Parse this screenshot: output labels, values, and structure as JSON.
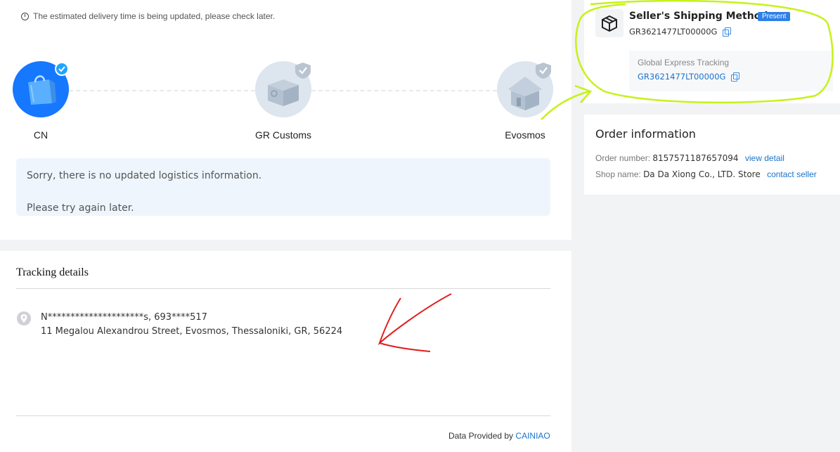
{
  "delivery_notice": "The estimated delivery time is being updated, please check later.",
  "progress": {
    "nodes": [
      {
        "label": "CN",
        "icon": "shopping-bag-icon",
        "status": "current"
      },
      {
        "label": "GR Customs",
        "icon": "customs-box-icon",
        "status": "pending"
      },
      {
        "label": "Evosmos",
        "icon": "house-icon",
        "status": "pending"
      }
    ]
  },
  "logistics_message": {
    "line1": "Sorry, there is no updated logistics information.",
    "line2": "Please try again later."
  },
  "tracking_details": {
    "title": "Tracking details",
    "recipient": "N*********************s,  693****517",
    "address": "11 Megalou Alexandrou Street,  Evosmos,  Thessaloniki,  GR,  56224"
  },
  "footer": {
    "prefix": "Data Provided by",
    "provider": "CAINIAO"
  },
  "shipping": {
    "title": "Seller's Shipping Method",
    "badge": "Present",
    "tracking_number": "GR3621477LT00000G",
    "global_label": "Global Express Tracking",
    "global_tracking_number": "GR3621477LT00000G"
  },
  "order": {
    "title": "Order information",
    "number_label": "Order number:",
    "number": "8157571187657094",
    "view_detail": "view detail",
    "shop_label": "Shop name:",
    "shop_name": "Da Da Xiong Co., LTD. Store",
    "contact_seller": "contact seller"
  },
  "colors": {
    "accent": "#1a73c9",
    "badge": "#2f7fe6",
    "active_node": "#1677ff",
    "annotation_green": "#c6f21a",
    "annotation_red": "#e0201f"
  }
}
